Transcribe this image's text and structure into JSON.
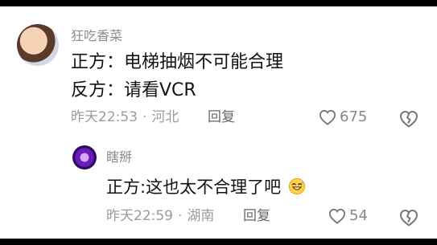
{
  "comments": [
    {
      "username": "狂吃香菜",
      "lines": [
        "正方：电梯抽烟不可能合理",
        "反方：请看VCR"
      ],
      "time": "昨天22:53",
      "separator": "·",
      "location": "河北",
      "reply_label": "回复",
      "likes": "675",
      "avatar_icon": "user-avatar-photo",
      "like_icon": "heart-outline-icon",
      "dislike_icon": "broken-heart-icon"
    },
    {
      "username": "瞎掰",
      "text": "正方:这也太不合理了吧",
      "emoji": "grinning-sweat-emoji",
      "time": "昨天22:59",
      "separator": "·",
      "location": "湖南",
      "reply_label": "回复",
      "likes": "54",
      "avatar_icon": "user-avatar-purple",
      "like_icon": "heart-outline-icon",
      "dislike_icon": "broken-heart-icon"
    }
  ],
  "colors": {
    "username": "#8b8b8b",
    "meta": "#9b9b9b",
    "text": "#111111",
    "icon": "#666666"
  }
}
